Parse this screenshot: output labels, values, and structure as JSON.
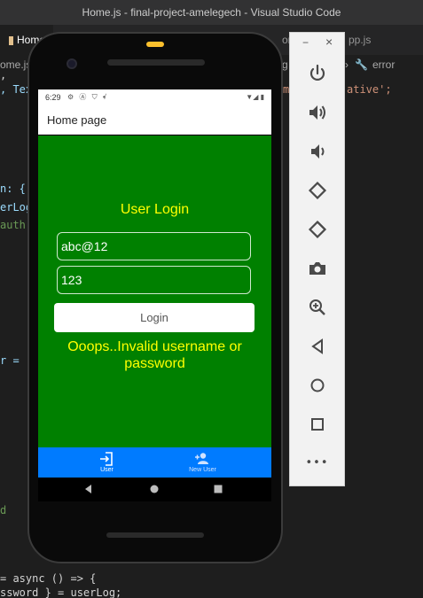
{
  "window": {
    "title": "Home.js - final-project-amelegech - Visual Studio Code"
  },
  "editor": {
    "tabs": [
      "Home",
      "on",
      "pp.js"
    ],
    "breadcrumb_left": "ome.js",
    "breadcrumb_right": "error",
    "code_fragments": [
      {
        "text": ", Tex",
        "color": "#9cdcfe"
      },
      {
        "text": "m",
        "color": "#ce9178"
      },
      {
        "text": "ative';",
        "color": "#ce9178"
      },
      {
        "text": "n: {",
        "color": "#9cdcfe"
      },
      {
        "text": "erLog",
        "color": "#9cdcfe"
      },
      {
        "text": "auth",
        "color": "#6a9955"
      },
      {
        "text": "r =",
        "color": "#9cdcfe"
      },
      {
        "text": "d",
        "color": "#6a9955"
      },
      {
        "text": "= async () => {",
        "color": "#d4d4d4"
      },
      {
        "text": "ssword } = userLog;",
        "color": "#d4d4d4"
      }
    ]
  },
  "phone": {
    "status": {
      "time": "6:29",
      "left_icons": "⚙ Ⓐ ⛉ •̸",
      "right_icons": "▼◢ ▮"
    },
    "header": {
      "title": "Home page"
    },
    "login": {
      "title": "User Login",
      "username_value": "abc@12",
      "password_value": "123",
      "button_label": "Login",
      "error_message": "Ooops..Invalid username or password"
    },
    "tabbar": {
      "tabs": [
        {
          "label": "User",
          "icon": "login-icon",
          "active": true
        },
        {
          "label": "New User",
          "icon": "add-user-icon",
          "active": false
        }
      ]
    },
    "colors": {
      "background": "#008000",
      "accent_text": "#ffff00",
      "tabbar": "#007bff"
    }
  },
  "emulator_panel": {
    "window_controls": {
      "minimize": "−",
      "close": "×"
    },
    "buttons": [
      "power-icon",
      "volume-up-icon",
      "volume-down-icon",
      "rotate-left-icon",
      "rotate-right-icon",
      "camera-icon",
      "zoom-icon",
      "back-icon",
      "home-icon",
      "overview-icon",
      "more-icon"
    ],
    "more_label": "•••"
  }
}
